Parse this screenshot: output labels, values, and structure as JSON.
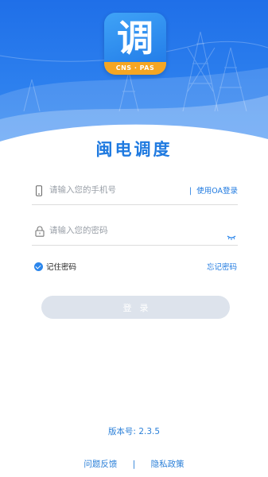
{
  "app": {
    "logo_char": "调",
    "logo_band_text": "CNS · PAS",
    "title": "闽电调度"
  },
  "login": {
    "phone_placeholder": "请输入您的手机号",
    "oa_separator": "|",
    "oa_login_label": "使用OA登录",
    "password_placeholder": "请输入您的密码",
    "remember_label": "记住密码",
    "remember_checked": true,
    "forgot_label": "忘记密码",
    "submit_label": "登录"
  },
  "footer": {
    "version_label": "版本号:",
    "version_value": "2.3.5",
    "feedback_label": "问题反馈",
    "separator": "|",
    "privacy_label": "隐私政策"
  },
  "colors": {
    "brand_blue": "#1f7ae0",
    "header_blue": "#2d80ee",
    "logo_band": "#f5a623",
    "button_disabled": "#dde3ec"
  }
}
